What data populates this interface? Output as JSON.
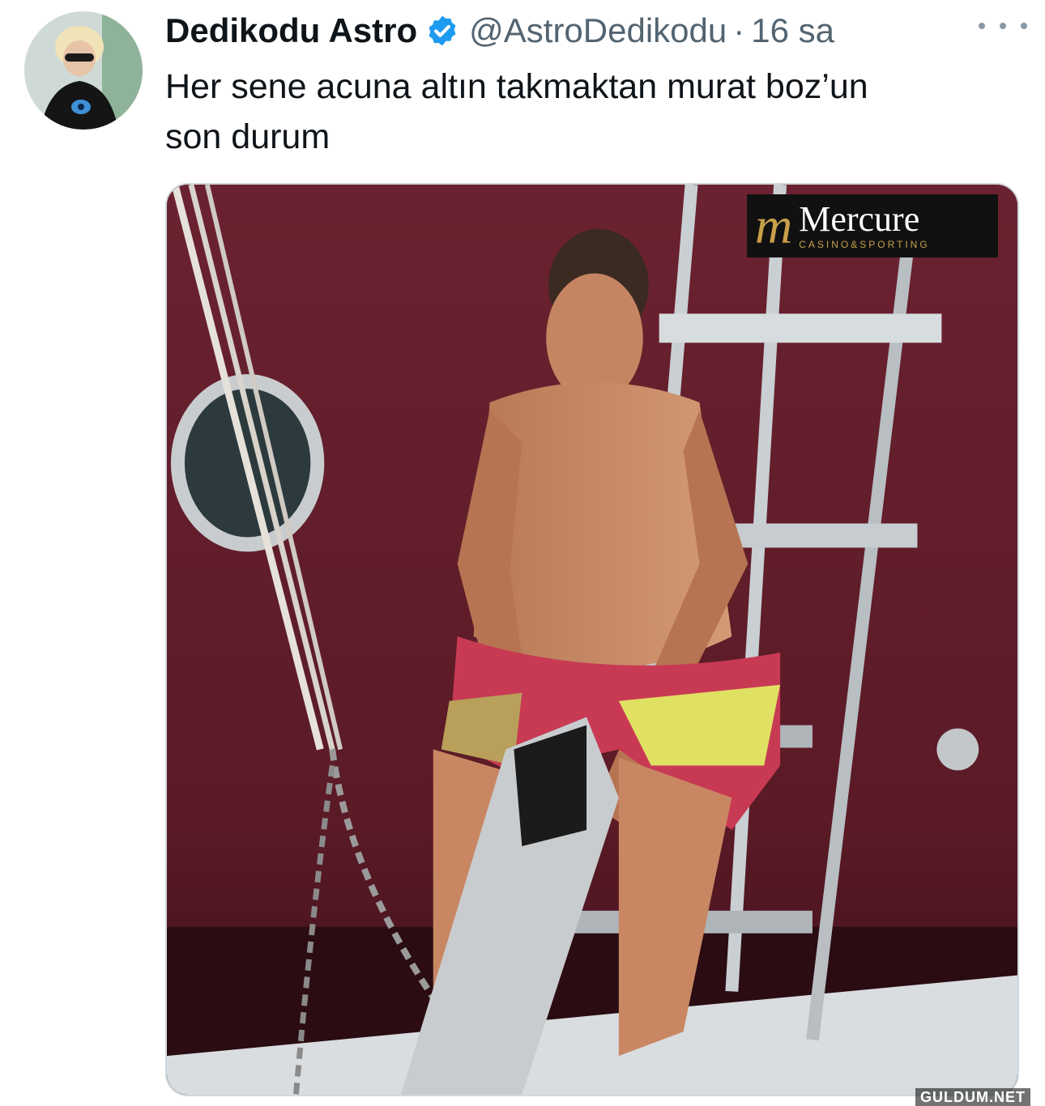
{
  "tweet": {
    "display_name": "Dedikodu Astro",
    "verified_icon": "verified-badge-icon",
    "handle": "@AstroDedikodu",
    "separator": "·",
    "time": "16 sa",
    "more_icon": "more-options-icon",
    "text_line1": "Her sene acuna altın takmaktan murat boz’un",
    "text_line2": "son durum",
    "avatar_icon": "user-avatar",
    "media_icon": "photo-man-on-boat-ladder"
  },
  "media": {
    "logo_mark": "m",
    "logo_name": "Mercure",
    "logo_sub": "CASINO&SPORTING"
  },
  "watermark": "GULDUM.NET",
  "colors": {
    "verified": "#1d9bf0",
    "secondary_text": "#536471",
    "logo_gold": "#c8a04a"
  }
}
